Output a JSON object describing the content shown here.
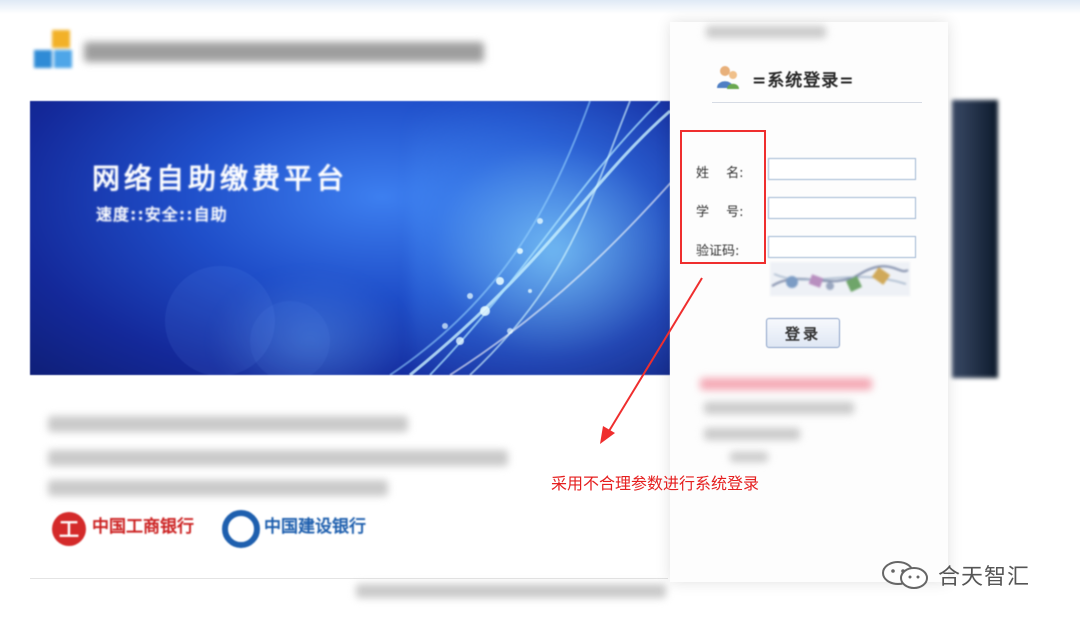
{
  "banner": {
    "title": "网络自助缴费平台",
    "subtitle": "速度::安全::自助"
  },
  "banks": {
    "icbc_glyph": "工",
    "icbc_name": "中国工商银行",
    "ccb_name": "中国建设银行"
  },
  "login": {
    "title": "=系统登录=",
    "fields": [
      {
        "label": "姓　 名:",
        "value": ""
      },
      {
        "label": "学　 号:",
        "value": ""
      },
      {
        "label": "验证码:",
        "value": ""
      }
    ],
    "button_label": "登录"
  },
  "annotation": {
    "text": "采用不合理参数进行系统登录",
    "color": "#e51f1f"
  },
  "watermark": {
    "text": "合天智汇",
    "icon": "wechat-icon"
  },
  "colors": {
    "banner_blue": "#1f4ec9",
    "highlight_red": "#ef2e2e",
    "icbc_red": "#cc2222",
    "ccb_blue": "#1e5fae"
  }
}
